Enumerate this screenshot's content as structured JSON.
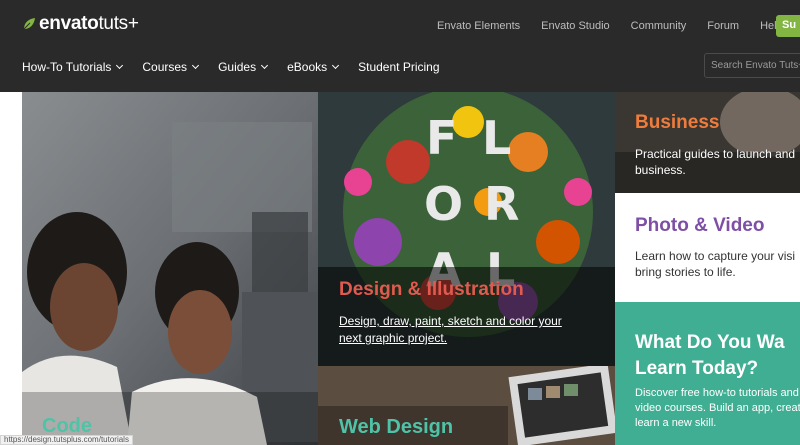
{
  "brand": {
    "name": "envato",
    "suffix": "tuts+",
    "accent": "#82b541"
  },
  "top_links": [
    "Envato Elements",
    "Envato Studio",
    "Community",
    "Forum",
    "Help"
  ],
  "signup_label": "Su",
  "main_nav": [
    {
      "label": "How-To Tutorials",
      "has_menu": true
    },
    {
      "label": "Courses",
      "has_menu": true
    },
    {
      "label": "Guides",
      "has_menu": true
    },
    {
      "label": "eBooks",
      "has_menu": true
    },
    {
      "label": "Student Pricing",
      "has_menu": false
    }
  ],
  "search": {
    "placeholder": "Search Envato Tuts+"
  },
  "tiles": {
    "code": {
      "title": "Code",
      "color": "#4fc3a8"
    },
    "design": {
      "title": "Design & Illustration",
      "desc_line1": "Design, draw, paint, sketch and color your",
      "desc_line2": "next graphic project.",
      "color": "#e05a4f",
      "art_letters": [
        "F",
        "L",
        "O",
        "R",
        "A",
        "L"
      ]
    },
    "web": {
      "title": "Web Design",
      "color": "#4fc3a8"
    },
    "business": {
      "title": "Business",
      "desc_line1": "Practical guides to launch and",
      "desc_line2": "business.",
      "color": "#f07c3c"
    },
    "photo": {
      "title": "Photo & Video",
      "desc_line1": "Learn how to capture your visi",
      "desc_line2": "bring stories to life.",
      "color": "#7e4fa5"
    },
    "learn": {
      "title_line1": "What Do You Wa",
      "title_line2": "Learn Today?",
      "desc_line1": "Discover free how-to tutorials and",
      "desc_line2": "video courses. Build an app, create",
      "desc_line3": "learn a new skill.",
      "color": "#3fae93"
    }
  },
  "status_bar_url": "https://design.tutsplus.com/tutorials"
}
